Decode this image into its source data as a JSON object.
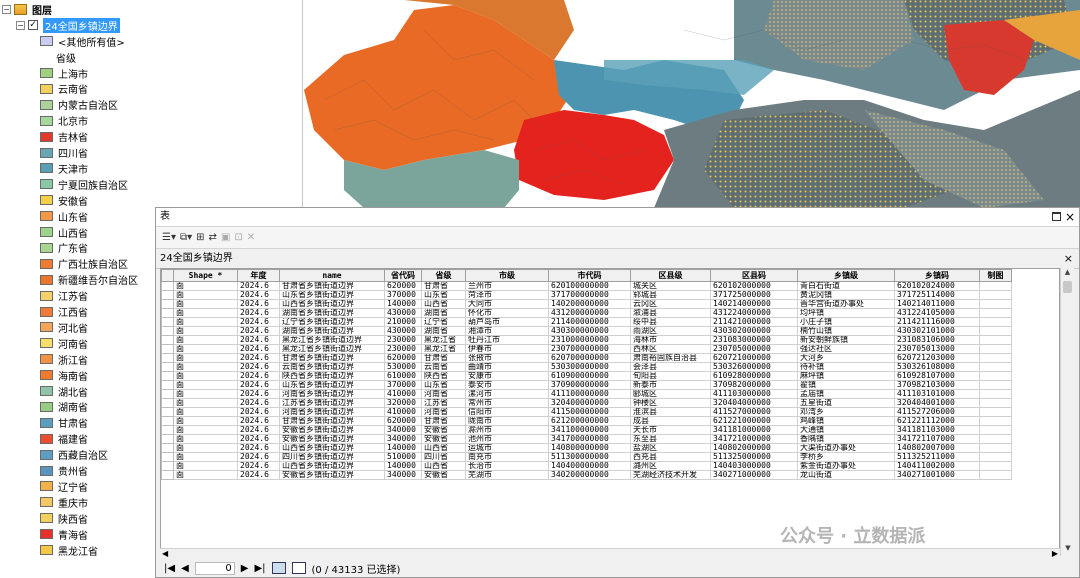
{
  "toc": {
    "root_label": "图层",
    "layer_name": "24全国乡镇边界",
    "other_label": "<其他所有值>",
    "field_label": "省级",
    "items": [
      {
        "label": "上海市",
        "color": "#9fd17e"
      },
      {
        "label": "云南省",
        "color": "#f2d15c"
      },
      {
        "label": "内蒙古自治区",
        "color": "#a9d39b"
      },
      {
        "label": "北京市",
        "color": "#a8d8a0"
      },
      {
        "label": "吉林省",
        "color": "#e03a2e"
      },
      {
        "label": "四川省",
        "color": "#6aa5b3"
      },
      {
        "label": "天津市",
        "color": "#5a9fb5"
      },
      {
        "label": "宁夏回族自治区",
        "color": "#8ac7a6"
      },
      {
        "label": "安徽省",
        "color": "#f3d04a"
      },
      {
        "label": "山东省",
        "color": "#f3974a"
      },
      {
        "label": "山西省",
        "color": "#9dd48b"
      },
      {
        "label": "广东省",
        "color": "#a7d48f"
      },
      {
        "label": "广西壮族自治区",
        "color": "#f07b36"
      },
      {
        "label": "新疆维吾尔自治区",
        "color": "#e8772e"
      },
      {
        "label": "江苏省",
        "color": "#f7d26c"
      },
      {
        "label": "江西省",
        "color": "#f07a3a"
      },
      {
        "label": "河北省",
        "color": "#f4a55a"
      },
      {
        "label": "河南省",
        "color": "#f7dd6a"
      },
      {
        "label": "浙江省",
        "color": "#f09248"
      },
      {
        "label": "海南省",
        "color": "#f07b2e"
      },
      {
        "label": "湖北省",
        "color": "#8fc4a8"
      },
      {
        "label": "湖南省",
        "color": "#9bcc85"
      },
      {
        "label": "甘肃省",
        "color": "#5a9fc0"
      },
      {
        "label": "福建省",
        "color": "#e8502f"
      },
      {
        "label": "西藏自治区",
        "color": "#5f9dc2"
      },
      {
        "label": "贵州省",
        "color": "#5a95bd"
      },
      {
        "label": "辽宁省",
        "color": "#f1b24a"
      },
      {
        "label": "重庆市",
        "color": "#f5c864"
      },
      {
        "label": "陕西省",
        "color": "#f3cf5e"
      },
      {
        "label": "青海省",
        "color": "#e6302b"
      },
      {
        "label": "黑龙江省",
        "color": "#f5c84a"
      }
    ]
  },
  "table_window": {
    "title": "表",
    "tab_label": "24全国乡镇边界",
    "close": "×"
  },
  "columns": [
    "Shape *",
    "年度",
    "name",
    "省代码",
    "省级",
    "市级",
    "市代码",
    "区县级",
    "区县码",
    "乡镇级",
    "乡镇码",
    "制图"
  ],
  "rows": [
    [
      "面",
      "2024.6",
      "甘肃省乡镇街道边界",
      "620000",
      "甘肃省",
      "兰州市",
      "620100000000",
      "城关区",
      "620102000000",
      "青白石街道",
      "620102024000",
      ""
    ],
    [
      "面",
      "2024.6",
      "山东省乡镇街道边界",
      "370000",
      "山东省",
      "菏泽市",
      "371700000000",
      "郓城县",
      "371725000000",
      "黄泥冈镇",
      "371725114000",
      ""
    ],
    [
      "面",
      "2024.6",
      "山西省乡镇街道边界",
      "140000",
      "山西省",
      "大同市",
      "140200000000",
      "云冈区",
      "140214000000",
      "晋华宫街道办事处",
      "140214011000",
      ""
    ],
    [
      "面",
      "2024.6",
      "湖南省乡镇街道边界",
      "430000",
      "湖南省",
      "怀化市",
      "431200000000",
      "溆浦县",
      "431224000000",
      "均坪镇",
      "431224105000",
      ""
    ],
    [
      "面",
      "2024.6",
      "辽宁省乡镇街道边界",
      "210000",
      "辽宁省",
      "葫芦岛市",
      "211400000000",
      "绥中县",
      "211421000000",
      "小庄子镇",
      "211421116000",
      ""
    ],
    [
      "面",
      "2024.6",
      "湖南省乡镇街道边界",
      "430000",
      "湖南省",
      "湘潭市",
      "430300000000",
      "雨湖区",
      "430302000000",
      "楠竹山镇",
      "430302101000",
      ""
    ],
    [
      "面",
      "2024.6",
      "黑龙江省乡镇街道边界",
      "230000",
      "黑龙江省",
      "牡丹江市",
      "231000000000",
      "海林市",
      "231083000000",
      "新安朝鲜族镇",
      "231083106000",
      ""
    ],
    [
      "面",
      "2024.6",
      "黑龙江省乡镇街道边界",
      "230000",
      "黑龙江省",
      "伊春市",
      "230700000000",
      "西林区",
      "230705000000",
      "强达社区",
      "230705013000",
      ""
    ],
    [
      "面",
      "2024.6",
      "甘肃省乡镇街道边界",
      "620000",
      "甘肃省",
      "张掖市",
      "620700000000",
      "肃南裕固族自治县",
      "620721000000",
      "大河乡",
      "620721203000",
      ""
    ],
    [
      "面",
      "2024.6",
      "云南省乡镇街道边界",
      "530000",
      "云南省",
      "曲靖市",
      "530300000000",
      "会泽县",
      "530326000000",
      "待补镇",
      "530326108000",
      ""
    ],
    [
      "面",
      "2024.6",
      "陕西省乡镇街道边界",
      "610000",
      "陕西省",
      "安康市",
      "610900000000",
      "旬阳县",
      "610928000000",
      "麻坪镇",
      "610928107000",
      ""
    ],
    [
      "面",
      "2024.6",
      "山东省乡镇街道边界",
      "370000",
      "山东省",
      "泰安市",
      "370900000000",
      "新泰市",
      "370982000000",
      "翟镇",
      "370982103000",
      ""
    ],
    [
      "面",
      "2024.6",
      "河南省乡镇街道边界",
      "410000",
      "河南省",
      "漯河市",
      "411100000000",
      "郾城区",
      "411103000000",
      "孟庙镇",
      "411103101000",
      ""
    ],
    [
      "面",
      "2024.6",
      "江苏省乡镇街道边界",
      "320000",
      "江苏省",
      "常州市",
      "320400000000",
      "钟楼区",
      "320404000000",
      "五星街道",
      "320404001000",
      ""
    ],
    [
      "面",
      "2024.6",
      "河南省乡镇街道边界",
      "410000",
      "河南省",
      "信阳市",
      "411500000000",
      "淮滨县",
      "411527000000",
      "邓湾乡",
      "411527206000",
      ""
    ],
    [
      "面",
      "2024.6",
      "甘肃省乡镇街道边界",
      "620000",
      "甘肃省",
      "陇南市",
      "621200000000",
      "成县",
      "621221000000",
      "鸡峰镇",
      "621221112000",
      ""
    ],
    [
      "面",
      "2024.6",
      "安徽省乡镇街道边界",
      "340000",
      "安徽省",
      "滁州市",
      "341100000000",
      "天长市",
      "341181000000",
      "大通镇",
      "341181103000",
      ""
    ],
    [
      "面",
      "2024.6",
      "安徽省乡镇街道边界",
      "340000",
      "安徽省",
      "池州市",
      "341700000000",
      "东至县",
      "341721000000",
      "香隅镇",
      "341721107000",
      ""
    ],
    [
      "面",
      "2024.6",
      "山西省乡镇街道边界",
      "140000",
      "山西省",
      "运城市",
      "140800000000",
      "盐湖区",
      "140802000000",
      "大渠街道办事处",
      "140802007000",
      ""
    ],
    [
      "面",
      "2024.6",
      "四川省乡镇街道边界",
      "510000",
      "四川省",
      "南充市",
      "511300000000",
      "西充县",
      "511325000000",
      "李桥乡",
      "511325211000",
      ""
    ],
    [
      "面",
      "2024.6",
      "山西省乡镇街道边界",
      "140000",
      "山西省",
      "长治市",
      "140400000000",
      "潞州区",
      "140403000000",
      "紫金街道办事处",
      "140411002000",
      ""
    ],
    [
      "面",
      "2024.6",
      "安徽省乡镇街道边界",
      "340000",
      "安徽省",
      "芜湖市",
      "340200000000",
      "芜湖经济技术开发",
      "340271000000",
      "龙山街道",
      "340271001000",
      ""
    ]
  ],
  "status": {
    "current": "0",
    "selection": "(0 / 43133 已选择)"
  },
  "watermark": "公众号 · 立数据派"
}
